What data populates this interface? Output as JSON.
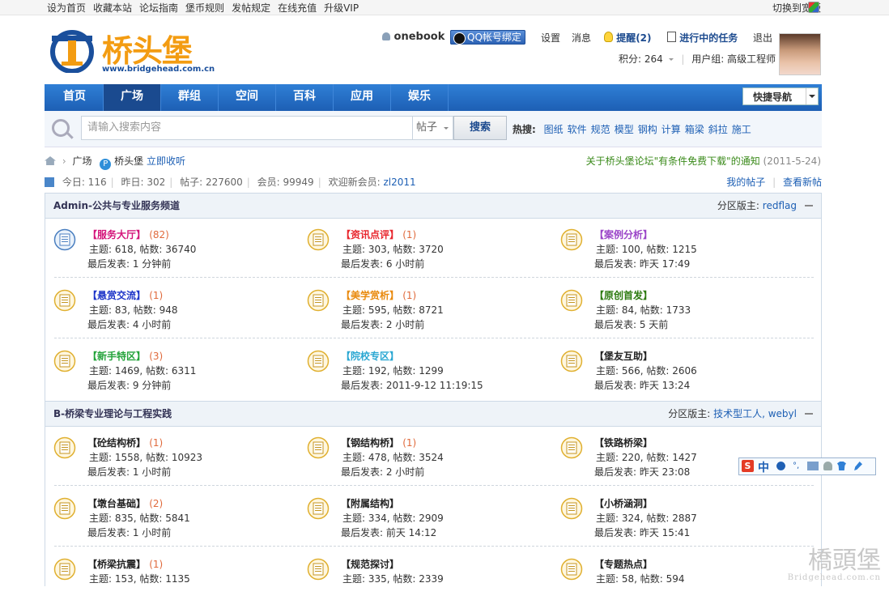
{
  "topbar": {
    "links": [
      "设为首页",
      "收藏本站",
      "论坛指南",
      "堡币规则",
      "发帖规定",
      "在线充值",
      "升级VIP"
    ],
    "switch_width": "切换到宽版"
  },
  "logo": {
    "name": "桥头堡",
    "url": "www.bridgehead.com.cn"
  },
  "user": {
    "name": "onebook",
    "qq_bind": "QQ帐号绑定",
    "settings": "设置",
    "messages": "消息",
    "reminders": "提醒(2)",
    "tasks": "进行中的任务",
    "logout": "退出",
    "points_label": "积分: 264",
    "group_label": "用户组: 高级工程师"
  },
  "nav": {
    "items": [
      "首页",
      "广场",
      "群组",
      "空间",
      "百科",
      "应用",
      "娱乐"
    ],
    "active": "广场",
    "quick_nav": "快捷导航"
  },
  "search": {
    "placeholder": "请输入搜索内容",
    "scope": "帖子",
    "button": "搜索",
    "hot_label": "热搜:",
    "hot_terms": [
      "图纸",
      "软件",
      "规范",
      "模型",
      "钢构",
      "计算",
      "箱梁",
      "斜拉",
      "施工"
    ]
  },
  "breadcrumb": {
    "sep": "›",
    "current": "广场",
    "forum": "桥头堡",
    "favorite": "立即收听"
  },
  "notice": {
    "text": "关于桥头堡论坛\"有条件免费下载\"的通知",
    "date": "(2011-5-24)"
  },
  "stats": {
    "today": "今日: 116",
    "yesterday": "昨日: 302",
    "posts": "帖子: 227600",
    "members": "会员: 99949",
    "new_member_label": "欢迎新会员:",
    "new_member": "zl2011",
    "my_posts": "我的帖子",
    "new_posts": "查看新帖"
  },
  "sections": [
    {
      "title": "Admin-公共与专业服务频道",
      "mods_label": "分区版主:",
      "mods": "redflag",
      "forums": [
        {
          "name": "【服务大厅】",
          "color": "#d4147a",
          "count": "(82)",
          "topics": "主题: 618, 帖数: 36740",
          "last": "最后发表: 1 分钟前",
          "icon": "gear"
        },
        {
          "name": "【资讯点评】",
          "color": "#e8262d",
          "count": "(1)",
          "topics": "主题: 303, 帖数: 3720",
          "last": "最后发表: 6 小时前",
          "icon": "doc"
        },
        {
          "name": "【案例分析】",
          "color": "#9b45c8",
          "count": "",
          "topics": "主题: 100, 帖数: 1215",
          "last": "最后发表: 昨天 17:49",
          "icon": "doc"
        },
        {
          "name": "【悬赏交流】",
          "color": "#1d34c8",
          "count": "(1)",
          "topics": "主题: 83, 帖数: 948",
          "last": "最后发表: 4 小时前",
          "icon": "doc"
        },
        {
          "name": "【美学赏析】",
          "color": "#e98a0e",
          "count": "(1)",
          "topics": "主题: 595, 帖数: 8721",
          "last": "最后发表: 2 小时前",
          "icon": "doc"
        },
        {
          "name": "【原创首发】",
          "color": "#2d7a10",
          "count": "",
          "topics": "主题: 84, 帖数: 1733",
          "last": "最后发表: 5 天前",
          "icon": "doc"
        },
        {
          "name": "【新手特区】",
          "color": "#23a33a",
          "count": "(3)",
          "topics": "主题: 1469, 帖数: 6311",
          "last": "最后发表: 9 分钟前",
          "icon": "doc"
        },
        {
          "name": "【院校专区】",
          "color": "#2aa7d2",
          "count": "",
          "topics": "主题: 192, 帖数: 1299",
          "last": "最后发表: 2011-9-12 11:19:15",
          "icon": "doc"
        },
        {
          "name": "【堡友互助】",
          "color": "#222222",
          "count": "",
          "topics": "主题: 566, 帖数: 2606",
          "last": "最后发表: 昨天 13:24",
          "icon": "doc"
        }
      ]
    },
    {
      "title": "B-桥梁专业理论与工程实践",
      "mods_label": "分区版主:",
      "mods": "技术型工人, webyl",
      "forums": [
        {
          "name": "【砼结构桥】",
          "color": "#222222",
          "count": "(1)",
          "topics": "主题: 1558, 帖数: 10923",
          "last": "最后发表: 1 小时前",
          "icon": "doc"
        },
        {
          "name": "【钢结构桥】",
          "color": "#222222",
          "count": "(1)",
          "topics": "主题: 478, 帖数: 3524",
          "last": "最后发表: 2 小时前",
          "icon": "doc"
        },
        {
          "name": "【铁路桥梁】",
          "color": "#222222",
          "count": "",
          "topics": "主题: 220, 帖数: 1427",
          "last": "最后发表: 昨天 23:08",
          "icon": "doc"
        },
        {
          "name": "【墩台基础】",
          "color": "#222222",
          "count": "(2)",
          "topics": "主题: 835, 帖数: 5841",
          "last": "最后发表: 1 小时前",
          "icon": "doc"
        },
        {
          "name": "【附属结构】",
          "color": "#222222",
          "count": "",
          "topics": "主题: 334, 帖数: 2909",
          "last": "最后发表: 前天 14:12",
          "icon": "doc"
        },
        {
          "name": "【小桥涵洞】",
          "color": "#222222",
          "count": "",
          "topics": "主题: 324, 帖数: 2887",
          "last": "最后发表: 昨天 15:41",
          "icon": "doc"
        },
        {
          "name": "【桥梁抗震】",
          "color": "#222222",
          "count": "(1)",
          "topics": "主题: 153, 帖数: 1135",
          "last": "",
          "icon": "doc"
        },
        {
          "name": "【规范探讨】",
          "color": "#222222",
          "count": "",
          "topics": "主题: 335, 帖数: 2339",
          "last": "",
          "icon": "doc"
        },
        {
          "name": "【专题热点】",
          "color": "#222222",
          "count": "",
          "topics": "主题: 58, 帖数: 594",
          "last": "",
          "icon": "doc"
        }
      ]
    }
  ],
  "ime": {
    "logo": "S",
    "mode": "中"
  },
  "watermark": {
    "text": "橋頭堡",
    "url": "Bridgehead.com.cn"
  }
}
